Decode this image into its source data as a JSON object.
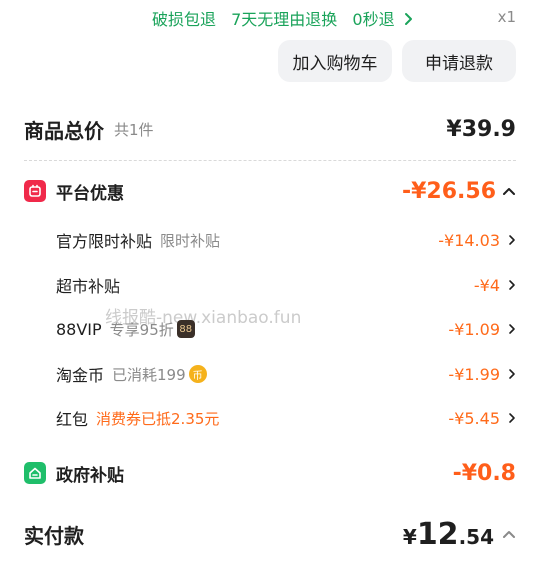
{
  "banner": {
    "items": [
      "破损包退",
      "7天无理由退换",
      "0秒退"
    ],
    "quantity": "x1"
  },
  "buttons": {
    "add_to_cart": "加入购物车",
    "request_refund": "申请退款"
  },
  "total": {
    "label": "商品总价",
    "count": "共1件",
    "value": "¥39.9"
  },
  "platform_discount": {
    "title": "平台优惠",
    "value": "-¥26.56",
    "items": [
      {
        "label": "官方限时补贴",
        "note": "限时补贴",
        "value": "-¥14.03"
      },
      {
        "label": "超市补贴",
        "note": "",
        "value": "-¥4"
      },
      {
        "label": "88VIP",
        "note": "专享95折",
        "badge": "88",
        "value": "-¥1.09"
      },
      {
        "label": "淘金币",
        "note": "已消耗199",
        "badge": "币",
        "value": "-¥1.99"
      },
      {
        "label": "红包",
        "note": "消费券已抵2.35元",
        "value": "-¥5.45"
      }
    ]
  },
  "gov_subsidy": {
    "title": "政府补贴",
    "value": "-¥0.8"
  },
  "paid": {
    "label": "实付款",
    "currency": "¥",
    "integer": "12",
    "decimal": ".54"
  },
  "watermark": "线报酷-new.xianbao.fun",
  "colors": {
    "green": "#1aa35a",
    "orange": "#ff5e1a",
    "red_badge": "#f0294a",
    "green_badge": "#1fbe6a"
  }
}
